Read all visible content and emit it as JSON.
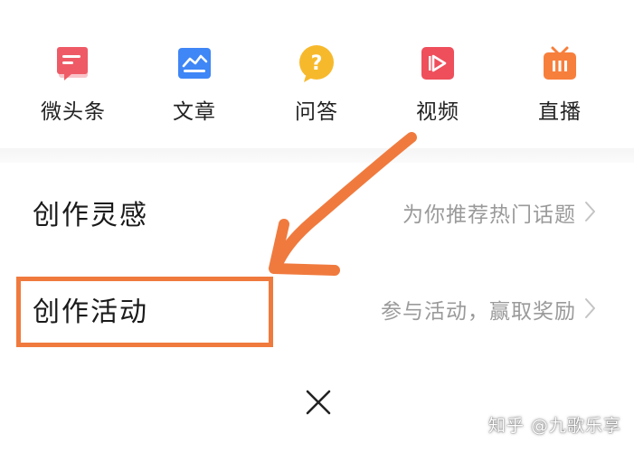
{
  "quick_actions": [
    {
      "label": "微头条",
      "icon": "micro-headline-icon",
      "color": "#ee5b66"
    },
    {
      "label": "文章",
      "icon": "article-icon",
      "color": "#3f86f6"
    },
    {
      "label": "问答",
      "icon": "qa-icon",
      "color": "#f7b92c"
    },
    {
      "label": "视频",
      "icon": "video-icon",
      "color": "#ee4f5b"
    },
    {
      "label": "直播",
      "icon": "live-icon",
      "color": "#f77f3c"
    }
  ],
  "rows": {
    "inspiration": {
      "title": "创作灵感",
      "hint": "为你推荐热门话题"
    },
    "activity": {
      "title": "创作活动",
      "hint": "参与活动，赢取奖励"
    }
  },
  "annotation": {
    "color": "#f07a3e"
  },
  "close": {
    "icon": "close-icon"
  },
  "watermark": {
    "text": "知乎 @九歌乐享"
  }
}
